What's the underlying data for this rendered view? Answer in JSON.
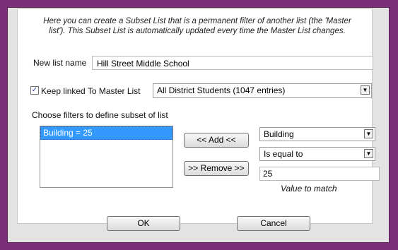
{
  "description": "Here you can create a Subset List that is a permanent filter of another list (the 'Master list'). This Subset List is automatically updated every time the Master List changes.",
  "new_list": {
    "label": "New list name",
    "value": "Hill Street Middle School"
  },
  "keep_linked": {
    "checked": true,
    "check_glyph": "✓",
    "label": "Keep linked To Master List",
    "master_list_value": "All District Students (1047 entries)"
  },
  "filters": {
    "heading": "Choose filters to define subset of list",
    "items": [
      "Building = 25"
    ],
    "add_label": "<< Add <<",
    "remove_label": ">> Remove >>",
    "field_value": "Building",
    "operator_value": "Is equal to",
    "match_value": "25",
    "match_caption": "Value to match"
  },
  "buttons": {
    "ok": "OK",
    "cancel": "Cancel"
  },
  "colors": {
    "frame": "#7a2f78",
    "selection": "#3399ff"
  },
  "icons": {
    "dropdown": "chevron-down-icon",
    "check": "checkmark-icon"
  }
}
